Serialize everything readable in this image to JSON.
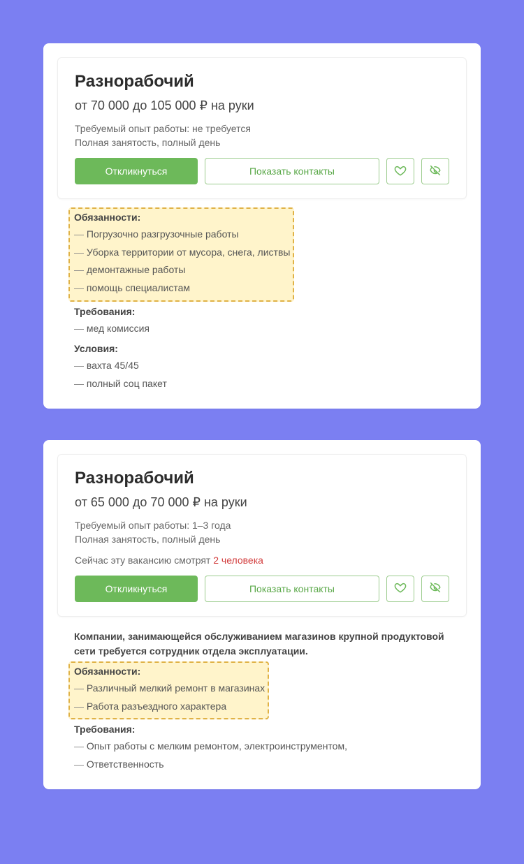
{
  "cards": [
    {
      "title": "Разнорабочий",
      "salary": "от 70 000 до 105 000 ₽ на руки",
      "experience": "Требуемый опыт работы: не требуется",
      "employment": "Полная занятость, полный день",
      "apply_label": "Откликнуться",
      "contacts_label": "Показать контакты",
      "resp_title": "Обязанности:",
      "resp": [
        "Погрузочно разгрузочные работы",
        "Уборка территории от мусора, снега, листвы",
        "демонтажные работы",
        "помощь специалистам"
      ],
      "req_title": "Требования:",
      "req": [
        "мед комиссия"
      ],
      "cond_title": "Условия:",
      "cond": [
        "вахта 45/45",
        "полный соц пакет"
      ]
    },
    {
      "title": "Разнорабочий",
      "salary": "от 65 000 до 70 000 ₽ на руки",
      "experience": "Требуемый опыт работы: 1–3 года",
      "employment": "Полная занятость, полный день",
      "viewers_prefix": "Сейчас эту вакансию смотрят ",
      "viewers_count": "2 человека",
      "apply_label": "Откликнуться",
      "contacts_label": "Показать контакты",
      "intro": "Компании, занимающейся обслуживанием магазинов крупной продуктовой сети требуется сотрудник отдела эксплуатации.",
      "resp_title": "Обязанности:",
      "resp": [
        "Различный мелкий ремонт в магазинах",
        "Работа разъездного характера"
      ],
      "req_title": "Требования:",
      "req": [
        "Опыт работы с мелким ремонтом, электроинструментом,",
        "Ответственность"
      ]
    }
  ]
}
